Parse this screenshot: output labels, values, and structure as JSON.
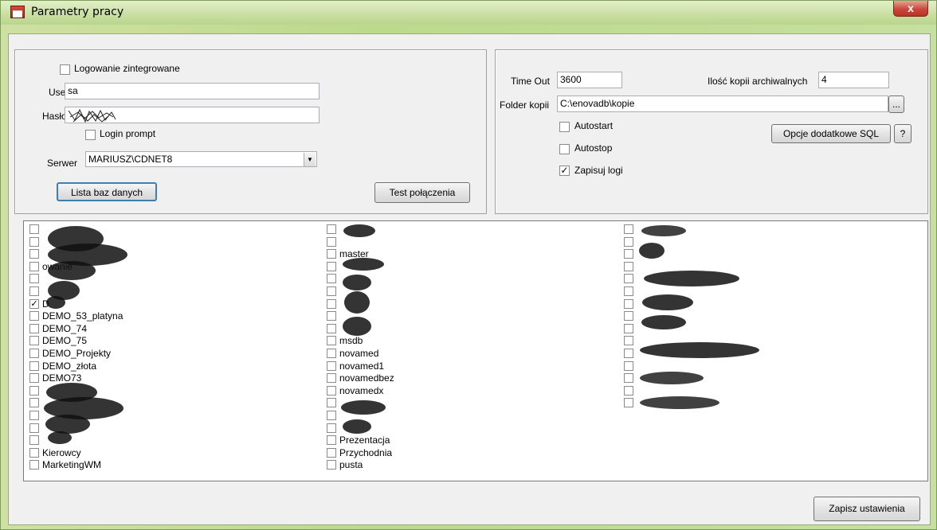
{
  "window": {
    "title": "Parametry pracy",
    "close_label": "x"
  },
  "login": {
    "integrated_label": "Logowanie zintegrowane",
    "user_label": "User",
    "user_value": "sa",
    "password_label": "Hasło",
    "login_prompt_label": "Login prompt",
    "server_label": "Serwer",
    "server_value": "MARIUSZ\\CDNET8",
    "list_db_button": "Lista baz danych",
    "test_button": "Test połączenia"
  },
  "backup": {
    "timeout_label": "Time Out",
    "timeout_value": "3600",
    "copies_label": "Ilość kopii archiwalnych",
    "copies_value": "4",
    "folder_label": "Folder kopii",
    "folder_value": "C:\\enovadb\\kopie",
    "browse_button": "...",
    "autostart_label": "Autostart",
    "autostop_label": "Autostop",
    "save_logs_label": "Zapisuj logi",
    "sql_options_button": "Opcje dodatkowe SQL",
    "help_button": "?"
  },
  "databases": {
    "col1": [
      {
        "name": "",
        "checked": false
      },
      {
        "name": "",
        "checked": false
      },
      {
        "name": "",
        "checked": false
      },
      {
        "name": "owanie",
        "checked": false
      },
      {
        "name": "",
        "checked": false
      },
      {
        "name": "",
        "checked": false
      },
      {
        "name": "D",
        "checked": true
      },
      {
        "name": "DEMO_53_platyna",
        "checked": false
      },
      {
        "name": "DEMO_74",
        "checked": false
      },
      {
        "name": "DEMO_75",
        "checked": false
      },
      {
        "name": "DEMO_Projekty",
        "checked": false
      },
      {
        "name": "DEMO_złota",
        "checked": false
      },
      {
        "name": "DEMO73",
        "checked": false
      },
      {
        "name": "",
        "checked": false
      },
      {
        "name": "",
        "checked": false
      },
      {
        "name": "",
        "checked": false
      },
      {
        "name": "",
        "checked": false
      },
      {
        "name": "",
        "checked": false
      },
      {
        "name": "Kierowcy",
        "checked": false
      },
      {
        "name": "MarketingWM",
        "checked": false
      }
    ],
    "col2": [
      {
        "name": "",
        "checked": false
      },
      {
        "name": "",
        "checked": false
      },
      {
        "name": "master",
        "checked": false
      },
      {
        "name": "",
        "checked": false
      },
      {
        "name": "",
        "checked": false
      },
      {
        "name": "",
        "checked": false
      },
      {
        "name": "",
        "checked": false
      },
      {
        "name": "",
        "checked": false
      },
      {
        "name": "",
        "checked": false
      },
      {
        "name": "msdb",
        "checked": false
      },
      {
        "name": "novamed",
        "checked": false
      },
      {
        "name": "novamed1",
        "checked": false
      },
      {
        "name": "novamedbez",
        "checked": false
      },
      {
        "name": "novamedx",
        "checked": false
      },
      {
        "name": "",
        "checked": false
      },
      {
        "name": "",
        "checked": false
      },
      {
        "name": "",
        "checked": false
      },
      {
        "name": "Prezentacja",
        "checked": false
      },
      {
        "name": "Przychodnia",
        "checked": false
      },
      {
        "name": "pusta",
        "checked": false
      }
    ],
    "col3": [
      {
        "name": "",
        "checked": false
      },
      {
        "name": "",
        "checked": false
      },
      {
        "name": "",
        "checked": false
      },
      {
        "name": "",
        "checked": false
      },
      {
        "name": "",
        "checked": false
      },
      {
        "name": "",
        "checked": false
      },
      {
        "name": "",
        "checked": false
      },
      {
        "name": "",
        "checked": false
      },
      {
        "name": "",
        "checked": false
      },
      {
        "name": "",
        "checked": false
      },
      {
        "name": "",
        "checked": false
      },
      {
        "name": "",
        "checked": false
      },
      {
        "name": "",
        "checked": false
      },
      {
        "name": "",
        "checked": false
      },
      {
        "name": "",
        "checked": false
      }
    ]
  },
  "footer": {
    "save_button": "Zapisz ustawienia"
  }
}
